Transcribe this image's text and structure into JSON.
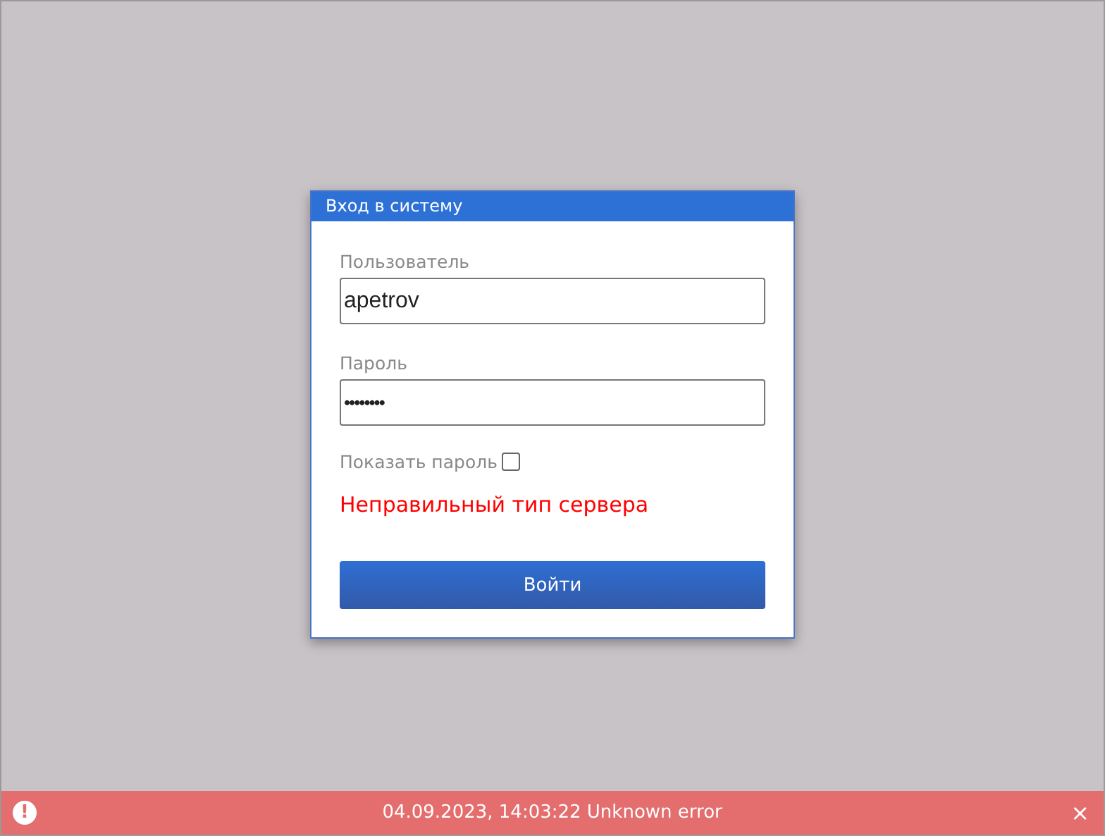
{
  "dialog": {
    "title": "Вход в систему",
    "username": {
      "label": "Пользователь",
      "value": "apetrov"
    },
    "password": {
      "label": "Пароль",
      "value": "••••••••"
    },
    "show_password": {
      "label": "Показать пароль",
      "checked": false
    },
    "error": "Неправильный тип сервера",
    "submit": "Войти"
  },
  "notification": {
    "icon": "!",
    "message": "04.09.2023, 14:03:22 Unknown error",
    "close": "×"
  }
}
